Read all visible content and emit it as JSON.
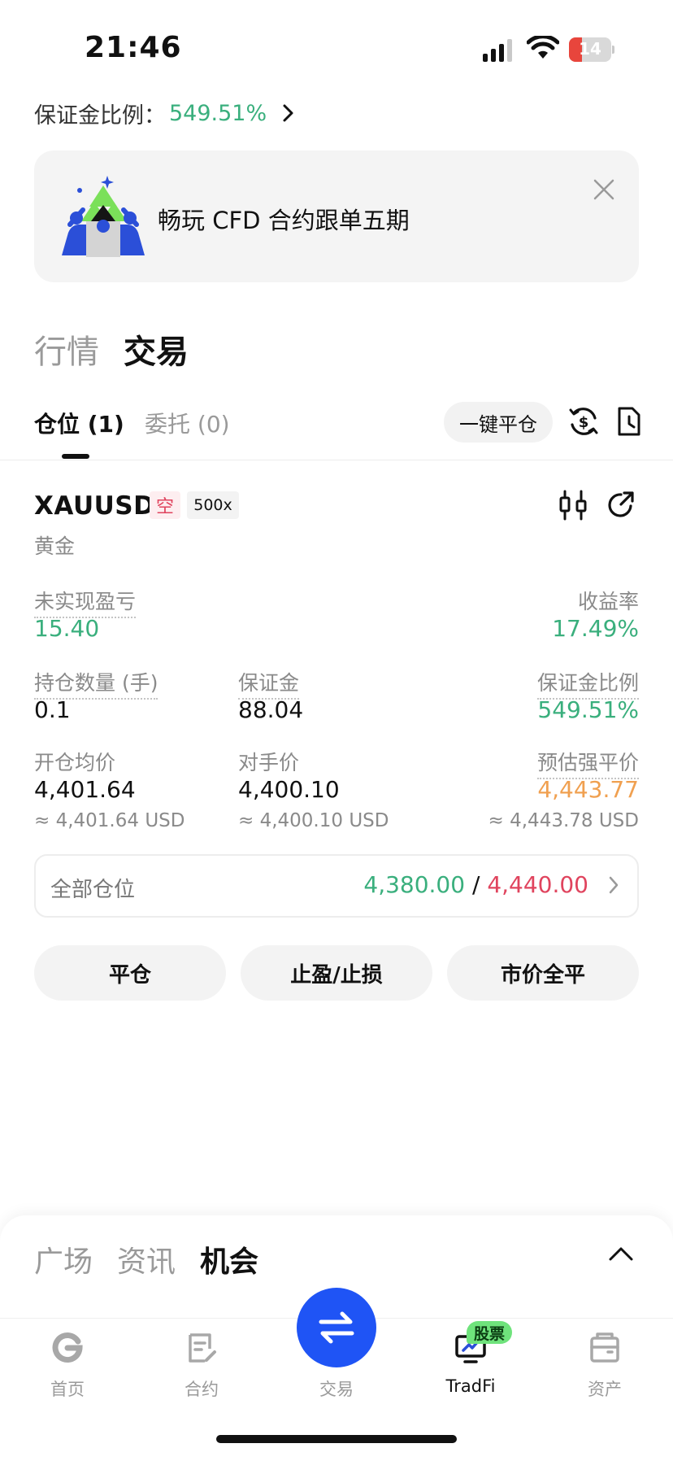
{
  "status_bar": {
    "time": "21:46",
    "battery": "14"
  },
  "margin_ratio": {
    "label": "保证金比例：",
    "value": "549.51%"
  },
  "banner": {
    "text": "畅玩 CFD 合约跟单五期"
  },
  "main_tabs": [
    {
      "label": "行情",
      "active": false
    },
    {
      "label": "交易",
      "active": true
    }
  ],
  "sub_tabs": [
    {
      "label": "仓位 (1)",
      "active": true
    },
    {
      "label": "委托 (0)",
      "active": false
    }
  ],
  "close_all_label": "一键平仓",
  "position": {
    "symbol": "XAUUSD",
    "side": "空",
    "leverage": "500x",
    "name": "黄金",
    "unrealized_pnl_label": "未实现盈亏",
    "unrealized_pnl": "15.40",
    "roe_label": "收益率",
    "roe": "17.49%",
    "qty_label": "持仓数量 (手)",
    "qty": "0.1",
    "margin_label": "保证金",
    "margin": "88.04",
    "margin_ratio_label": "保证金比例",
    "margin_ratio": "549.51%",
    "entry_label": "开仓均价",
    "entry": "4,401.64",
    "entry_usd": "≈ 4,401.64 USD",
    "counter_label": "对手价",
    "counter": "4,400.10",
    "counter_usd": "≈ 4,400.10 USD",
    "liq_label": "预估强平价",
    "liq": "4,443.77",
    "liq_usd": "≈ 4,443.78 USD"
  },
  "all_positions": {
    "label": "全部仓位",
    "tp": "4,380.00",
    "separator": "/",
    "sl": "4,440.00"
  },
  "actions": {
    "close": "平仓",
    "tpsl": "止盈/止损",
    "market_close": "市价全平"
  },
  "sheet_tabs": [
    {
      "label": "广场",
      "active": false
    },
    {
      "label": "资讯",
      "active": false
    },
    {
      "label": "机会",
      "active": true
    }
  ],
  "bottom_nav": [
    {
      "label": "首页",
      "icon": "home-icon"
    },
    {
      "label": "合约",
      "icon": "contract-icon"
    },
    {
      "label": "交易",
      "icon": "swap-icon"
    },
    {
      "label": "TradFi",
      "icon": "tradfi-icon",
      "tag": "股票",
      "active": true
    },
    {
      "label": "资产",
      "icon": "wallet-icon"
    }
  ],
  "colors": {
    "green": "#3aaf7d",
    "red": "#e0445e",
    "orange": "#f0a050",
    "brand_blue": "#1f54f5",
    "tag_green": "#6fe37c"
  }
}
